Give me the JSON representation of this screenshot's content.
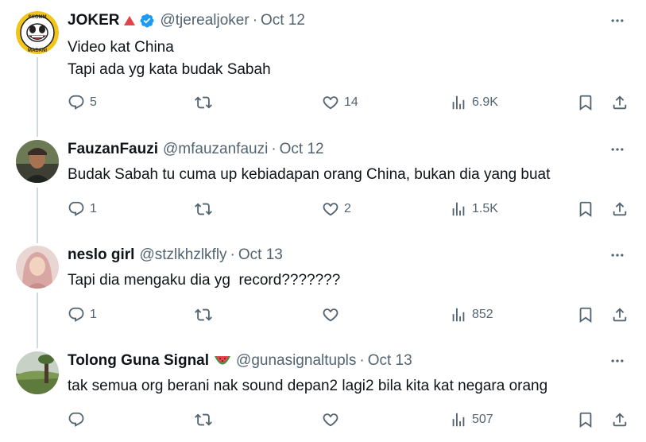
{
  "tweets": [
    {
      "name": "JOKER",
      "handle": "@tjerealjoker",
      "date": "Oct 12",
      "verified": true,
      "lines": [
        "Video kat China",
        "Tapi ada yg kata budak Sabah"
      ],
      "replies": "5",
      "retweets": "",
      "likes": "14",
      "views": "6.9K"
    },
    {
      "name": "FauzanFauzi",
      "handle": "@mfauzanfauzi",
      "date": "Oct 12",
      "verified": false,
      "lines": [
        "Budak Sabah tu cuma up kebiadapan orang China, bukan dia yang buat"
      ],
      "replies": "1",
      "retweets": "",
      "likes": "2",
      "views": "1.5K"
    },
    {
      "name": "neslo girl",
      "handle": "@stzlkhzlkfly",
      "date": "Oct 13",
      "verified": false,
      "lines": [
        "Tapi dia mengaku dia yg  record???????"
      ],
      "replies": "1",
      "retweets": "",
      "likes": "",
      "views": "852"
    },
    {
      "name": "Tolong Guna Signal",
      "handle": "@gunasignaltupls",
      "date": "Oct 13",
      "verified": false,
      "lines": [
        "tak semua org berani nak sound depan2 lagi2 bila kita kat negara orang"
      ],
      "replies": "",
      "retweets": "",
      "likes": "",
      "views": "507"
    }
  ],
  "avatar_texts": {
    "joker_top": "SKOMM",
    "joker_bottom": "MADANI"
  },
  "icons": {
    "reply": "reply-icon",
    "retweet": "retweet-icon",
    "like": "like-icon",
    "views": "views-icon",
    "bookmark": "bookmark-icon",
    "share": "share-icon",
    "more": "more-icon",
    "verified": "verified-badge-icon",
    "red_triangle": "red-triangle-icon",
    "watermelon": "watermelon-emoji-icon"
  },
  "colors": {
    "text": "#0f1419",
    "muted": "#536471",
    "verified": "#1d9bf0",
    "thread_line": "#cfd9de"
  }
}
